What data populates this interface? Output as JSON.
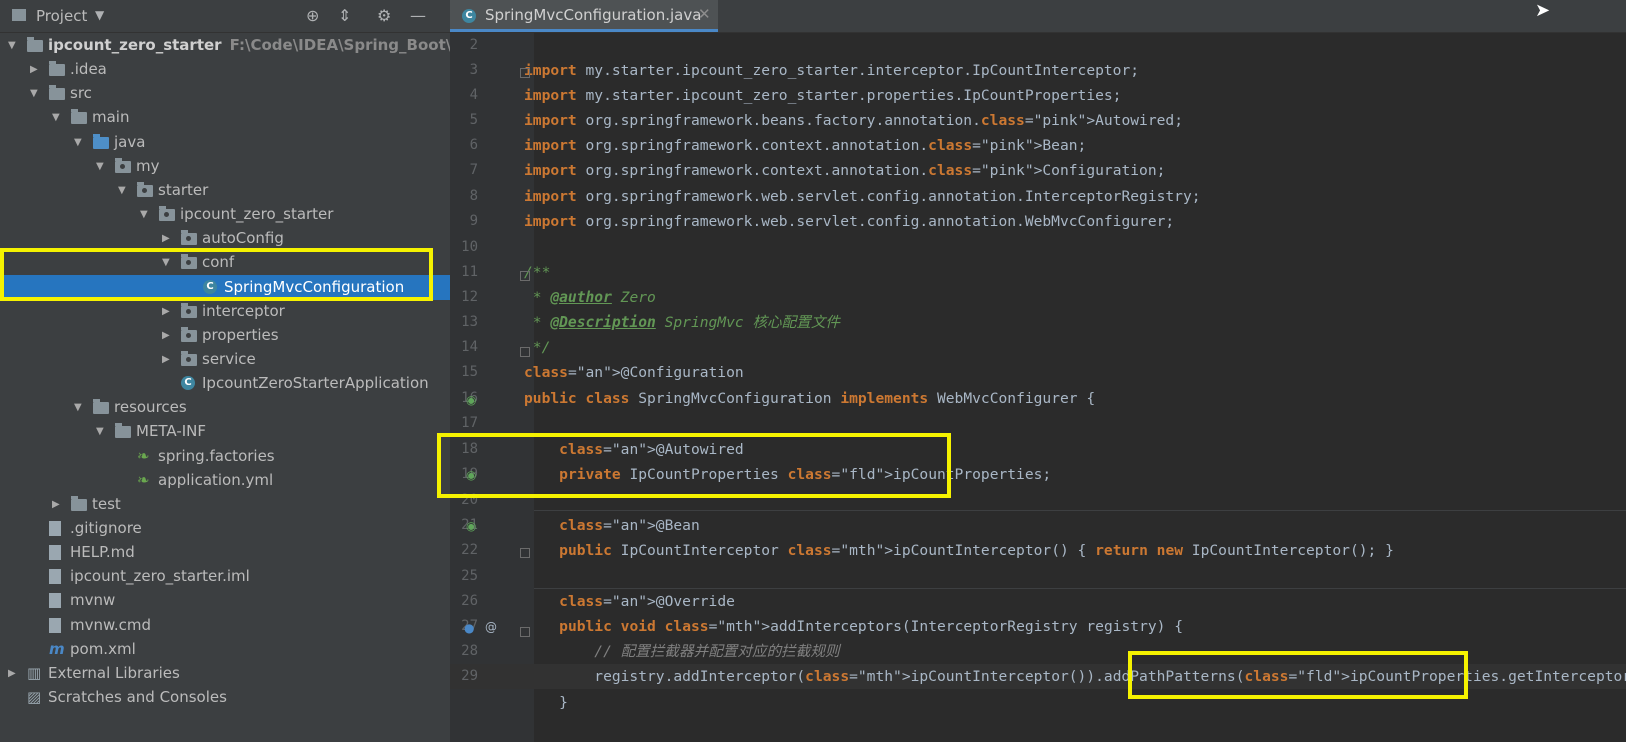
{
  "project_panel": {
    "title": "Project",
    "tree": [
      {
        "label": "ipcount_zero_starter",
        "extra": "F:\\Code\\IDEA\\Spring_Boot\\ipcou",
        "arrow": "▼",
        "icon": "module-folder-icon"
      },
      {
        "label": ".idea",
        "arrow": "▶",
        "icon": "folder-icon"
      },
      {
        "label": "src",
        "arrow": "▼",
        "icon": "folder-icon"
      },
      {
        "label": "main",
        "arrow": "▼",
        "icon": "folder-icon"
      },
      {
        "label": "java",
        "arrow": "▼",
        "icon": "source-folder-icon"
      },
      {
        "label": "my",
        "arrow": "▼",
        "icon": "package-icon"
      },
      {
        "label": "starter",
        "arrow": "▼",
        "icon": "package-icon"
      },
      {
        "label": "ipcount_zero_starter",
        "arrow": "▼",
        "icon": "package-icon"
      },
      {
        "label": "autoConfig",
        "arrow": "▶",
        "icon": "package-icon"
      },
      {
        "label": "conf",
        "arrow": "▼",
        "icon": "package-icon"
      },
      {
        "label": "SpringMvcConfiguration",
        "arrow": "",
        "icon": "class-icon"
      },
      {
        "label": "interceptor",
        "arrow": "▶",
        "icon": "package-icon"
      },
      {
        "label": "properties",
        "arrow": "▶",
        "icon": "package-icon"
      },
      {
        "label": "service",
        "arrow": "▶",
        "icon": "package-icon"
      },
      {
        "label": "IpcountZeroStarterApplication",
        "arrow": "",
        "icon": "spring-boot-class-icon"
      },
      {
        "label": "resources",
        "arrow": "▼",
        "icon": "resources-folder-icon"
      },
      {
        "label": "META-INF",
        "arrow": "▼",
        "icon": "folder-icon"
      },
      {
        "label": "spring.factories",
        "arrow": "",
        "icon": "spring-leaf-icon"
      },
      {
        "label": "application.yml",
        "arrow": "",
        "icon": "yaml-config-icon"
      },
      {
        "label": "test",
        "arrow": "▶",
        "icon": "folder-icon"
      },
      {
        "label": ".gitignore",
        "arrow": "",
        "icon": "file-icon"
      },
      {
        "label": "HELP.md",
        "arrow": "",
        "icon": "markdown-file-icon"
      },
      {
        "label": "ipcount_zero_starter.iml",
        "arrow": "",
        "icon": "file-icon"
      },
      {
        "label": "mvnw",
        "arrow": "",
        "icon": "file-icon"
      },
      {
        "label": "mvnw.cmd",
        "arrow": "",
        "icon": "file-icon"
      },
      {
        "label": "pom.xml",
        "arrow": "",
        "icon": "maven-icon"
      },
      {
        "label": "External Libraries",
        "arrow": "▶",
        "icon": "libraries-icon"
      },
      {
        "label": "Scratches and Consoles",
        "arrow": "",
        "icon": "scratches-icon"
      }
    ]
  },
  "editor": {
    "tab_label": "SpringMvcConfiguration.java",
    "lines": [
      {
        "n": "2",
        "text": ""
      },
      {
        "n": "3",
        "text": "import my.starter.ipcount_zero_starter.interceptor.IpCountInterceptor;"
      },
      {
        "n": "4",
        "text": "import my.starter.ipcount_zero_starter.properties.IpCountProperties;"
      },
      {
        "n": "5",
        "text": "import org.springframework.beans.factory.annotation.Autowired;"
      },
      {
        "n": "6",
        "text": "import org.springframework.context.annotation.Bean;"
      },
      {
        "n": "7",
        "text": "import org.springframework.context.annotation.Configuration;"
      },
      {
        "n": "8",
        "text": "import org.springframework.web.servlet.config.annotation.InterceptorRegistry;"
      },
      {
        "n": "9",
        "text": "import org.springframework.web.servlet.config.annotation.WebMvcConfigurer;"
      },
      {
        "n": "10",
        "text": ""
      },
      {
        "n": "11",
        "text": "/**"
      },
      {
        "n": "12",
        "text": " * @author Zero"
      },
      {
        "n": "13",
        "text": " * @Description SpringMvc 核心配置文件"
      },
      {
        "n": "14",
        "text": " */"
      },
      {
        "n": "15",
        "text": "@Configuration"
      },
      {
        "n": "16",
        "text": "public class SpringMvcConfiguration implements WebMvcConfigurer {"
      },
      {
        "n": "17",
        "text": ""
      },
      {
        "n": "18",
        "text": "    @Autowired"
      },
      {
        "n": "19",
        "text": "    private IpCountProperties ipCountProperties;"
      },
      {
        "n": "20",
        "text": ""
      },
      {
        "n": "21",
        "text": "    @Bean"
      },
      {
        "n": "22",
        "text": "    public IpCountInterceptor ipCountInterceptor() { return new IpCountInterceptor(); }"
      },
      {
        "n": "25",
        "text": ""
      },
      {
        "n": "26",
        "text": "    @Override"
      },
      {
        "n": "27",
        "text": "    public void addInterceptors(InterceptorRegistry registry) {"
      },
      {
        "n": "28",
        "text": "        // 配置拦截器并配置对应的拦截规则"
      },
      {
        "n": "29",
        "text": "        registry.addInterceptor(ipCountInterceptor()).addPathPatterns(ipCountProperties.getInterceptorPath());"
      },
      {
        "n": "",
        "text": "    }"
      }
    ]
  }
}
